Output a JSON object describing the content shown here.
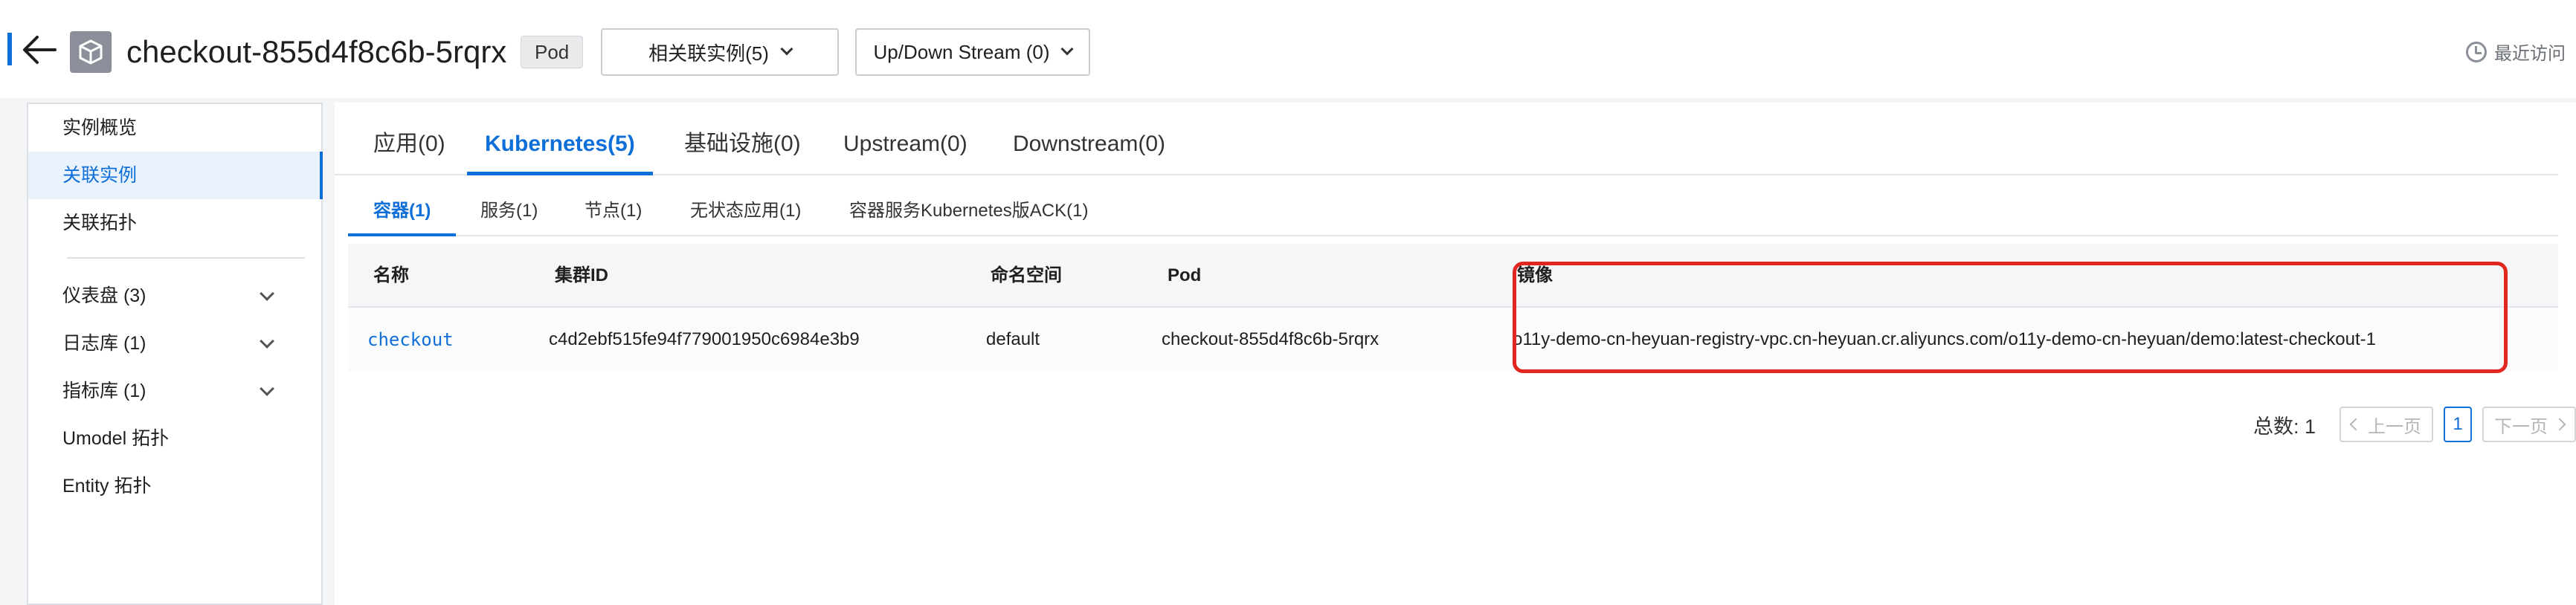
{
  "header": {
    "title": "checkout-855d4f8c6b-5rqrx",
    "badge": "Pod",
    "related_select": "相关联实例(5)",
    "updown_select": "Up/Down Stream (0)",
    "recent_label": "最近访问"
  },
  "sidebar": {
    "items": [
      {
        "label": "实例概览"
      },
      {
        "label": "关联实例"
      },
      {
        "label": "关联拓扑"
      },
      {
        "label": "仪表盘 (3)"
      },
      {
        "label": "日志库 (1)"
      },
      {
        "label": "指标库 (1)"
      },
      {
        "label": "Umodel 拓扑"
      },
      {
        "label": "Entity 拓扑"
      }
    ]
  },
  "main": {
    "tabs": [
      {
        "label": "应用(0)"
      },
      {
        "label": "Kubernetes(5)"
      },
      {
        "label": "基础设施(0)"
      },
      {
        "label": "Upstream(0)"
      },
      {
        "label": "Downstream(0)"
      }
    ],
    "subtabs": [
      {
        "label": "容器(1)"
      },
      {
        "label": "服务(1)"
      },
      {
        "label": "节点(1)"
      },
      {
        "label": "无状态应用(1)"
      },
      {
        "label": "容器服务Kubernetes版ACK(1)"
      }
    ],
    "table": {
      "columns": [
        "名称",
        "集群ID",
        "命名空间",
        "Pod",
        "镜像"
      ],
      "rows": [
        {
          "name": "checkout",
          "cluster_id": "c4d2ebf515fe94f779001950c6984e3b9",
          "namespace": "default",
          "pod": "checkout-855d4f8c6b-5rqrx",
          "image": "o11y-demo-cn-heyuan-registry-vpc.cn-heyuan.cr.aliyuncs.com/o11y-demo-cn-heyuan/demo:latest-checkout-1"
        }
      ]
    },
    "pagination": {
      "total": "总数: 1",
      "prev": "上一页",
      "current": "1",
      "next": "下一页"
    }
  },
  "colors": {
    "accent": "#0f6fd9",
    "highlight": "#e0281f",
    "active_bg": "#eaf3fd"
  },
  "icons": [
    "back-arrow-icon",
    "cube-icon",
    "chevron-down-icon",
    "clock-icon"
  ]
}
